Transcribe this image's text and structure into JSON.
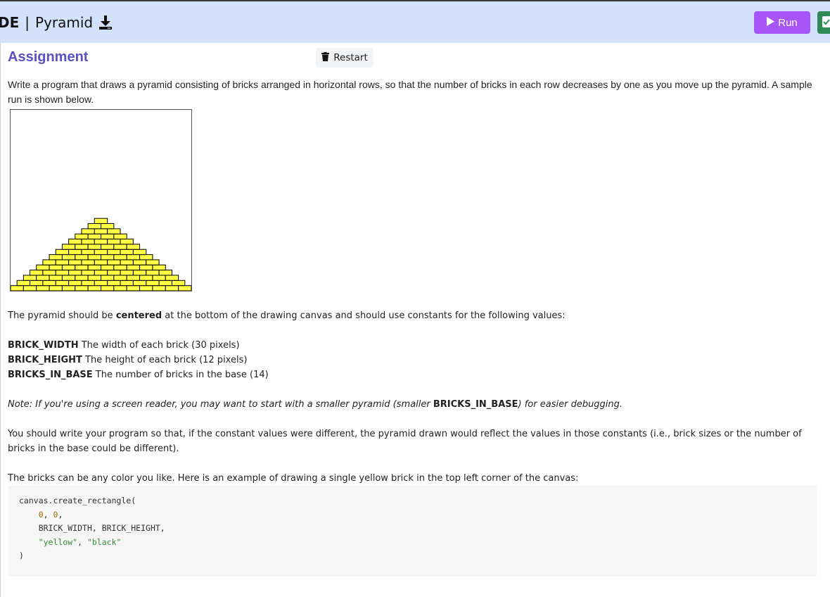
{
  "header": {
    "title_prefix": "DE",
    "title_separator": "|",
    "title": "Pyramid",
    "run_label": "Run",
    "colors": {
      "header_bg": "#d3e1fb",
      "run": "#a855f7",
      "submit": "#2e8b57"
    }
  },
  "assignment": {
    "heading": "Assignment",
    "restart_label": "Restart",
    "intro": "Write a program that draws a pyramid consisting of bricks arranged in horizontal rows, so that the number of bricks in each row decreases by one as you move up the pyramid. A sample run is shown below.",
    "centered_before": "The pyramid should be ",
    "centered_word": "centered",
    "centered_after": " at the bottom of the drawing canvas and should use constants for the following values:",
    "constants": [
      {
        "name": "BRICK_WIDTH",
        "desc": " The width of each brick (30 pixels)"
      },
      {
        "name": "BRICK_HEIGHT",
        "desc": " The height of each brick (12 pixels)"
      },
      {
        "name": "BRICKS_IN_BASE",
        "desc": " The number of bricks in the base (14)"
      }
    ],
    "note_before": "Note: If you're using a screen reader, you may want to start with a smaller pyramid (smaller ",
    "note_const": "BRICKS_IN_BASE",
    "note_after": ") for easier debugging.",
    "reflect": "You should write your program so that, if the constant values were different, the pyramid drawn would reflect the values in those constants (i.e., brick sizes or the number of bricks in the base could be different).",
    "color_para": "The bricks can be any color you like. Here is an example of drawing a single yellow brick in the top left corner of the canvas:",
    "code": {
      "line1": "canvas.create_rectangle(",
      "num1": "0",
      "comma": ", ",
      "num2": "0",
      "comma_end": ",",
      "line3": "BRICK_WIDTH, BRICK_HEIGHT,",
      "str1": "\"yellow\"",
      "str2": "\"black\"",
      "close": ")"
    }
  },
  "sample_run": {
    "bricks_in_base": 14,
    "brick_color": "#ffff44",
    "outline_color": "#000000"
  }
}
